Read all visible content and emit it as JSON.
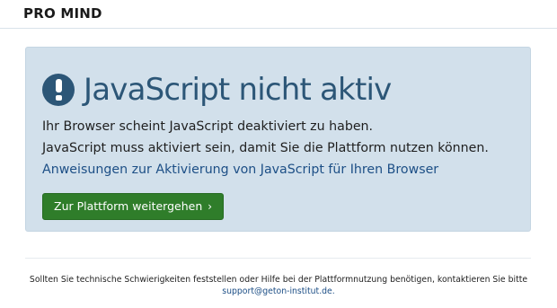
{
  "header": {
    "logo_text": "PRO MIND"
  },
  "alert": {
    "icon": "exclamation-circle-icon",
    "title": "JavaScript nicht aktiv",
    "line1": "Ihr Browser scheint JavaScript deaktiviert zu haben.",
    "line2": "JavaScript muss aktiviert sein, damit Sie die Plattform nutzen können.",
    "help_link": "Anweisungen zur Aktivierung von JavaScript für Ihren Browser",
    "button_label": "Zur Plattform weitergehen",
    "button_icon": "chevron-right-icon"
  },
  "footer": {
    "text": "Sollten Sie technische Schwierigkeiten feststellen oder Hilfe bei der Plattformnutzung benötigen, kontaktieren Sie bitte",
    "email": "support@geton-institut.de."
  },
  "colors": {
    "alert_background": "#d2e0eb",
    "heading": "#2c5677",
    "link": "#1d4f86",
    "button": "#2f7d2a"
  }
}
